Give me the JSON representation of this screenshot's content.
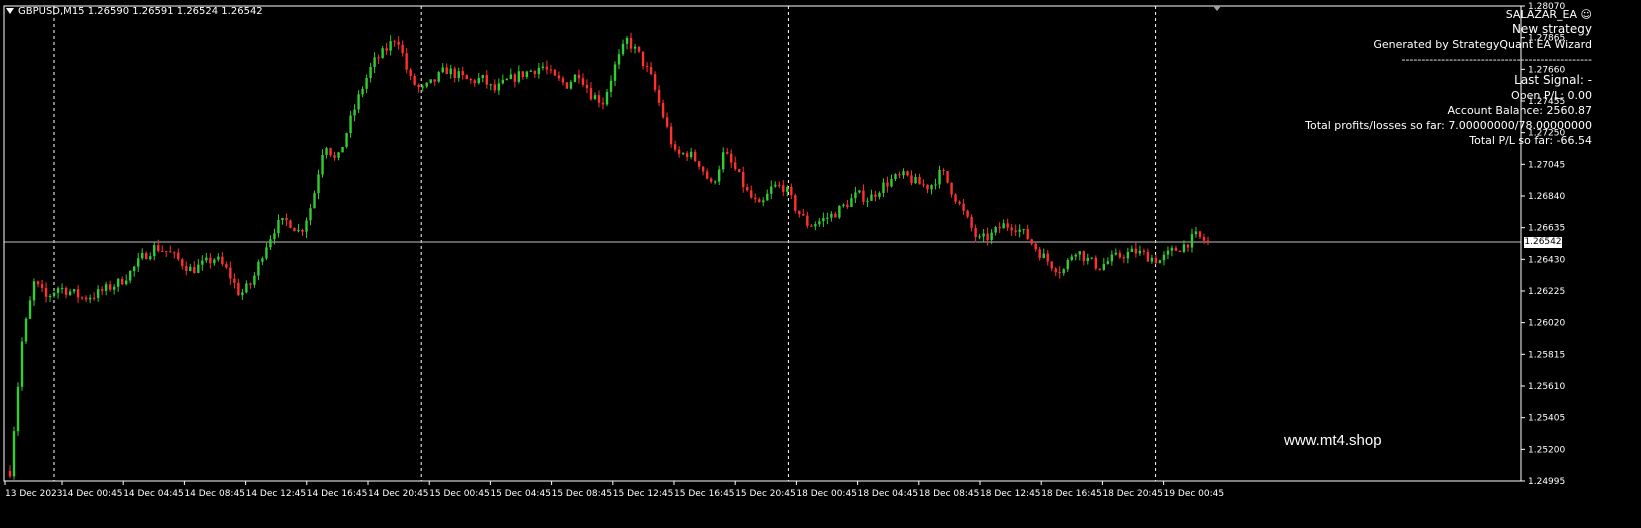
{
  "header": {
    "symbol_line": "GBPUSD,M15  1.26590 1.26591 1.26524 1.26542"
  },
  "ea_panel": {
    "ea_name": "SALAZAR_EA",
    "title": "New strategy",
    "generated_by": "Generated by StrategyQuant EA Wizard",
    "separator": "------------------------------------------------",
    "last_signal": "Last Signal:  -",
    "open_pl": "Open P/L: 0.00",
    "account_balance": "Account Balance: 2560.87",
    "total_profits_losses": "Total profits/losses so far: 7.00000000/78.00000000",
    "total_pl": "Total P/L so far: -66.54"
  },
  "watermark": "www.mt4.shop",
  "current_price_label": "1.26542",
  "colors": {
    "background": "#000000",
    "bull": "#32cd32",
    "bear": "#ff3030",
    "axis": "#ffffff",
    "grid": "#ffffff"
  },
  "chart_data": {
    "type": "candlestick",
    "timeframe": "M15",
    "symbol": "GBPUSD",
    "ylim": [
      1.24995,
      1.2807
    ],
    "y_ticks": [
      "1.28070",
      "1.27865",
      "1.27660",
      "1.27455",
      "1.27250",
      "1.27045",
      "1.26840",
      "1.26635",
      "1.26430",
      "1.26225",
      "1.26020",
      "1.25815",
      "1.25610",
      "1.25405",
      "1.25200",
      "1.24995"
    ],
    "x_ticks": [
      "13 Dec 2023",
      "14 Dec 00:45",
      "14 Dec 04:45",
      "14 Dec 08:45",
      "14 Dec 12:45",
      "14 Dec 16:45",
      "14 Dec 20:45",
      "15 Dec 00:45",
      "15 Dec 04:45",
      "15 Dec 08:45",
      "15 Dec 12:45",
      "15 Dec 16:45",
      "15 Dec 20:45",
      "18 Dec 00:45",
      "18 Dec 04:45",
      "18 Dec 08:45",
      "18 Dec 12:45",
      "18 Dec 16:45",
      "18 Dec 20:45",
      "19 Dec 00:45"
    ],
    "day_separators_at_tick_index": [
      1,
      7,
      13,
      19
    ],
    "current_price": 1.26542,
    "close_path": [
      [
        0,
        1.2506
      ],
      [
        2,
        1.259
      ],
      [
        4,
        1.2628
      ],
      [
        6,
        1.2618
      ],
      [
        8,
        1.2625
      ],
      [
        10,
        1.2622
      ],
      [
        12,
        1.2618
      ],
      [
        14,
        1.262
      ],
      [
        16,
        1.2624
      ],
      [
        18,
        1.2628
      ],
      [
        20,
        1.2635
      ],
      [
        22,
        1.2645
      ],
      [
        24,
        1.2651
      ],
      [
        26,
        1.2648
      ],
      [
        28,
        1.2642
      ],
      [
        30,
        1.2636
      ],
      [
        32,
        1.264
      ],
      [
        34,
        1.2644
      ],
      [
        36,
        1.2635
      ],
      [
        38,
        1.262
      ],
      [
        40,
        1.2628
      ],
      [
        42,
        1.265
      ],
      [
        44,
        1.2665
      ],
      [
        46,
        1.2668
      ],
      [
        48,
        1.266
      ],
      [
        50,
        1.268
      ],
      [
        52,
        1.272
      ],
      [
        54,
        1.2705
      ],
      [
        56,
        1.273
      ],
      [
        58,
        1.2752
      ],
      [
        60,
        1.277
      ],
      [
        62,
        1.2778
      ],
      [
        64,
        1.2788
      ],
      [
        66,
        1.276
      ],
      [
        68,
        1.2752
      ],
      [
        70,
        1.2758
      ],
      [
        72,
        1.2766
      ],
      [
        74,
        1.2762
      ],
      [
        76,
        1.2758
      ],
      [
        78,
        1.276
      ],
      [
        80,
        1.2752
      ],
      [
        82,
        1.2758
      ],
      [
        84,
        1.2762
      ],
      [
        86,
        1.2765
      ],
      [
        88,
        1.2768
      ],
      [
        90,
        1.276
      ],
      [
        92,
        1.2756
      ],
      [
        94,
        1.2764
      ],
      [
        96,
        1.275
      ],
      [
        98,
        1.2745
      ],
      [
        100,
        1.2768
      ],
      [
        102,
        1.2785
      ],
      [
        104,
        1.2775
      ],
      [
        106,
        1.276
      ],
      [
        108,
        1.2735
      ],
      [
        110,
        1.271
      ],
      [
        112,
        1.2712
      ],
      [
        114,
        1.2705
      ],
      [
        116,
        1.269
      ],
      [
        118,
        1.2712
      ],
      [
        120,
        1.27
      ],
      [
        122,
        1.2685
      ],
      [
        124,
        1.2676
      ],
      [
        126,
        1.269
      ],
      [
        128,
        1.269
      ],
      [
        130,
        1.2675
      ],
      [
        132,
        1.2665
      ],
      [
        134,
        1.2668
      ],
      [
        136,
        1.2672
      ],
      [
        138,
        1.2678
      ],
      [
        140,
        1.2685
      ],
      [
        142,
        1.2682
      ],
      [
        144,
        1.269
      ],
      [
        146,
        1.2695
      ],
      [
        148,
        1.2697
      ],
      [
        150,
        1.2692
      ],
      [
        152,
        1.269
      ],
      [
        154,
        1.27
      ],
      [
        156,
        1.2685
      ],
      [
        158,
        1.267
      ],
      [
        160,
        1.2655
      ],
      [
        162,
        1.2658
      ],
      [
        164,
        1.2665
      ],
      [
        166,
        1.2665
      ],
      [
        168,
        1.2658
      ],
      [
        170,
        1.2648
      ],
      [
        172,
        1.264
      ],
      [
        174,
        1.2635
      ],
      [
        176,
        1.265
      ],
      [
        178,
        1.2643
      ],
      [
        180,
        1.2638
      ],
      [
        182,
        1.2643
      ],
      [
        184,
        1.2646
      ],
      [
        186,
        1.2648
      ],
      [
        188,
        1.2645
      ],
      [
        190,
        1.2642
      ],
      [
        192,
        1.2648
      ],
      [
        194,
        1.2652
      ],
      [
        196,
        1.2658
      ],
      [
        198,
        1.2654
      ]
    ]
  }
}
